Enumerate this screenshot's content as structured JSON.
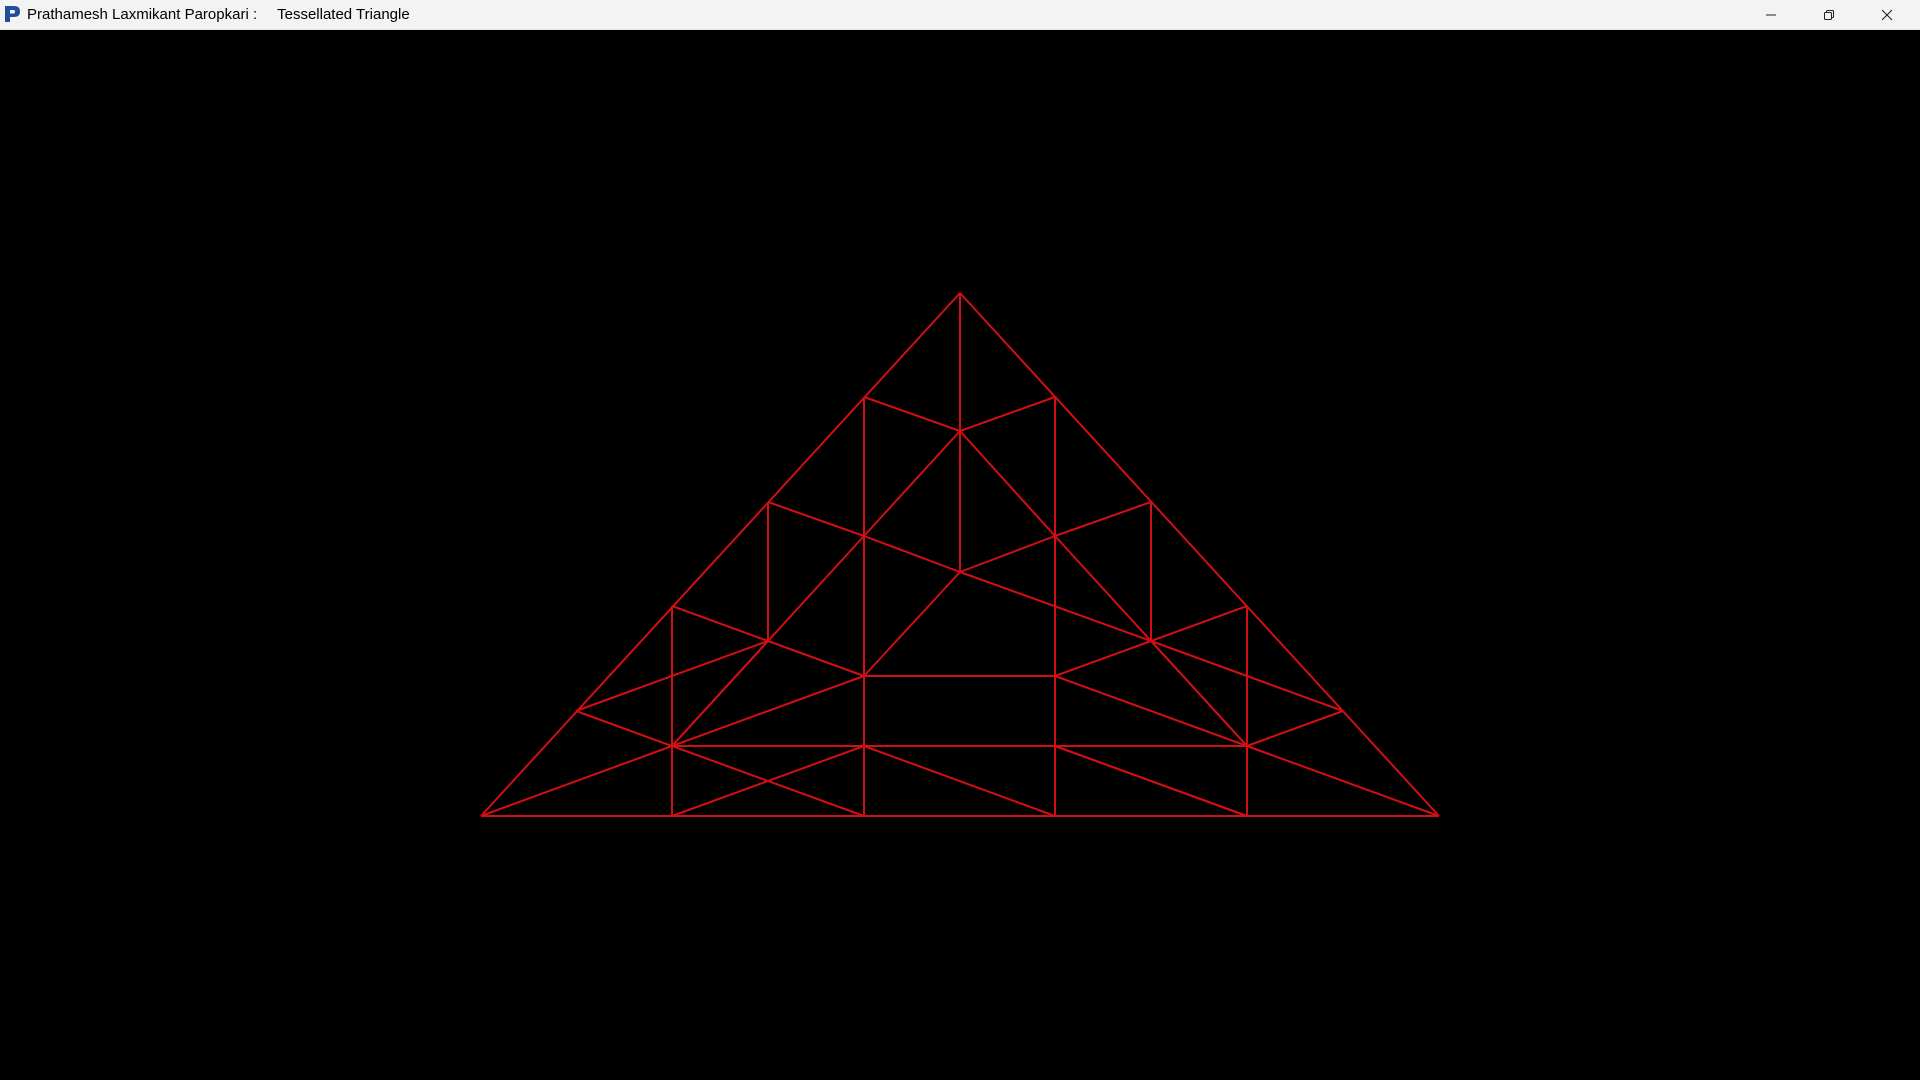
{
  "window": {
    "app_name": "Prathamesh Laxmikant Paropkari :",
    "title": "Tessellated Triangle",
    "app_icon": "letter-p-icon",
    "controls": {
      "minimize_icon": "minimize-icon",
      "restore_icon": "restore-icon",
      "close_icon": "close-icon"
    }
  },
  "scene": {
    "background_color": "#000000",
    "line_color": "#d10f14",
    "shape": "triangle",
    "subdivision_levels": 2
  }
}
